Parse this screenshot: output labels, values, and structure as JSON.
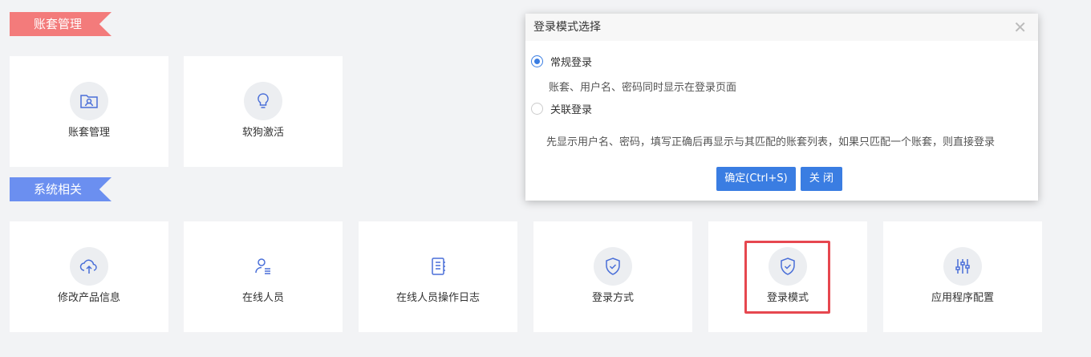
{
  "sections": {
    "account": "账套管理",
    "system": "系统相关"
  },
  "account_cards": [
    {
      "label": "账套管理",
      "icon": "folder-user-icon"
    },
    {
      "label": "软狗激活",
      "icon": "lightbulb-icon"
    }
  ],
  "system_cards": [
    {
      "label": "修改产品信息",
      "icon": "cloud-upload-icon"
    },
    {
      "label": "在线人员",
      "icon": "user-list-icon"
    },
    {
      "label": "在线人员操作日志",
      "icon": "notebook-icon"
    },
    {
      "label": "登录方式",
      "icon": "shield-check-icon"
    },
    {
      "label": "登录模式",
      "icon": "shield-check-icon"
    },
    {
      "label": "应用程序配置",
      "icon": "sliders-icon"
    }
  ],
  "dialog": {
    "title": "登录模式选择",
    "option1": {
      "label": "常规登录",
      "desc": "账套、用户名、密码同时显示在登录页面",
      "selected": true
    },
    "option2": {
      "label": "关联登录",
      "desc": "先显示用户名、密码，填写正确后再显示与其匹配的账套列表，如果只匹配一个账套，则直接登录",
      "selected": false
    },
    "confirm": "确定(Ctrl+S)",
    "close": "关 闭"
  },
  "colors": {
    "accent": "#3a7de2",
    "ribbon_red": "#f37b7b",
    "ribbon_blue": "#6b8ff0",
    "highlight": "#e6474f"
  }
}
